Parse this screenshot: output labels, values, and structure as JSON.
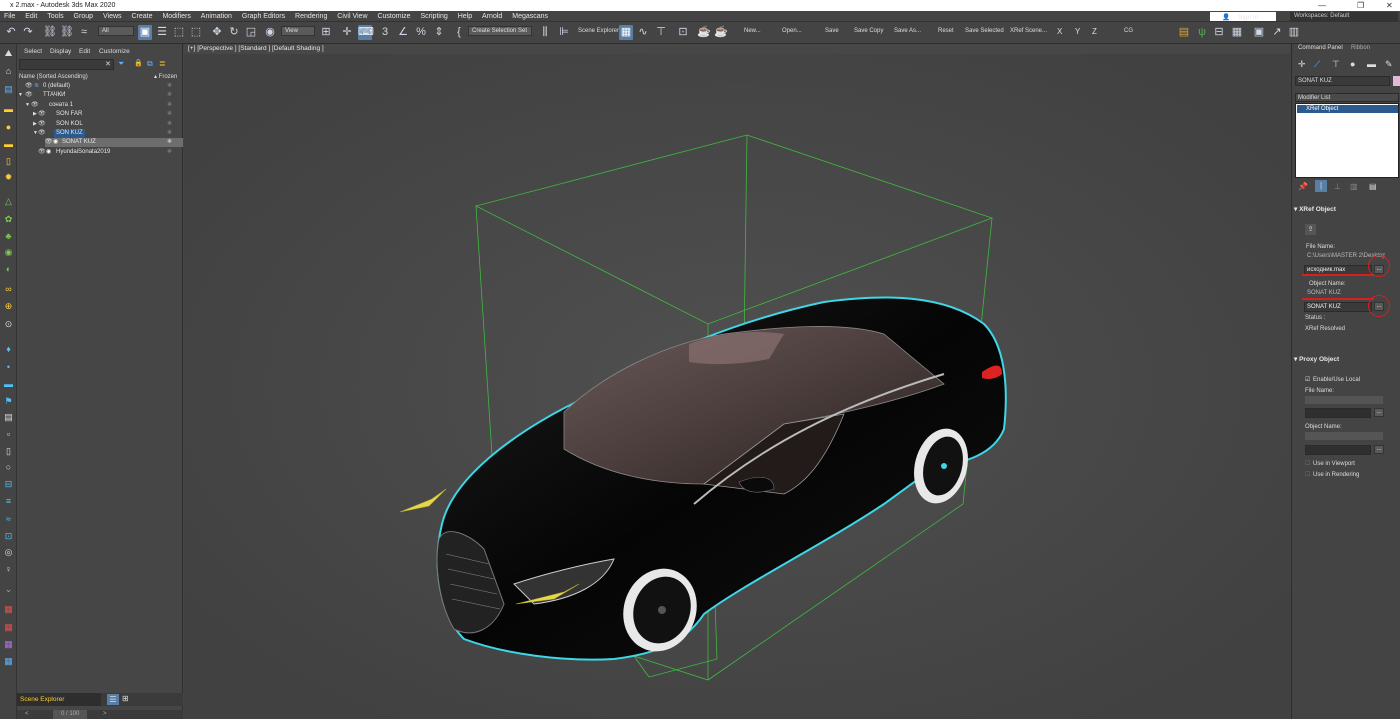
{
  "window": {
    "title": "x 2.max - Autodesk 3ds Max 2020",
    "controls": [
      "—",
      "❐",
      "✕"
    ]
  },
  "menu": [
    "File",
    "Edit",
    "Tools",
    "Group",
    "Views",
    "Create",
    "Modifiers",
    "Animation",
    "Graph Editors",
    "Rendering",
    "Civil View",
    "Customize",
    "Scripting",
    "Help",
    "Arnold",
    "Megascans"
  ],
  "signin": "Sign In",
  "workspaces": "Workspaces:  Default",
  "toolbar": {
    "filter": "All",
    "view": "View",
    "selection_set": "Create Selection Set",
    "scene_explorer": "Scene Explorer",
    "buttons": [
      "New...",
      "Open...",
      "Save",
      "Save Copy",
      "Save As...",
      "Reset",
      "Save Selected",
      "XRef Scene..."
    ],
    "axes": [
      "X",
      "Y",
      "Z"
    ],
    "cg": "CG"
  },
  "explorer": {
    "tabs": [
      "Select",
      "Display",
      "Edit",
      "Customize"
    ],
    "col_name": "Name (Sorted Ascending)",
    "col_frozen": "▴ Frozen",
    "rows": [
      {
        "name": "0 (default)"
      },
      {
        "name": "ТТАЧКИ"
      },
      {
        "name": "соната 1"
      },
      {
        "name": "SON FAR"
      },
      {
        "name": "SON KOL"
      },
      {
        "name": "SON KUZ"
      },
      {
        "name": "SONAT KUZ"
      },
      {
        "name": "HyundaiSonata2019"
      }
    ],
    "footer": "Scene Explorer",
    "timeline": "0 / 100"
  },
  "viewport": {
    "label": "[+] [Perspective ] [Standard ] [Default Shading ]"
  },
  "cmd": {
    "tabs": [
      "Command Panel",
      "Ribbon"
    ],
    "object_name": "SONAT KUZ",
    "modifier_list": "Modifier List",
    "stack_item": "XRef Object",
    "xref_header": "XRef Object",
    "file_name_label": "File Name:",
    "file_path": "C:\\Users\\MASTER 2\\Desktop",
    "file_value": "исходник.max",
    "object_name_label": "Object Name:",
    "object_name_value": "SONAT KUZ",
    "object_name_value2": "SONAT KUZ",
    "status_label": "Status :",
    "status_value": "XRef Resolved",
    "proxy_header": "Proxy Object",
    "enable_local": "Enable/Use Local",
    "proxy_file_label": "File Name:",
    "proxy_obj_label": "Object Name:",
    "use_viewport": "Use in Viewport",
    "use_rendering": "Use in Rendering",
    "browse": "..."
  }
}
